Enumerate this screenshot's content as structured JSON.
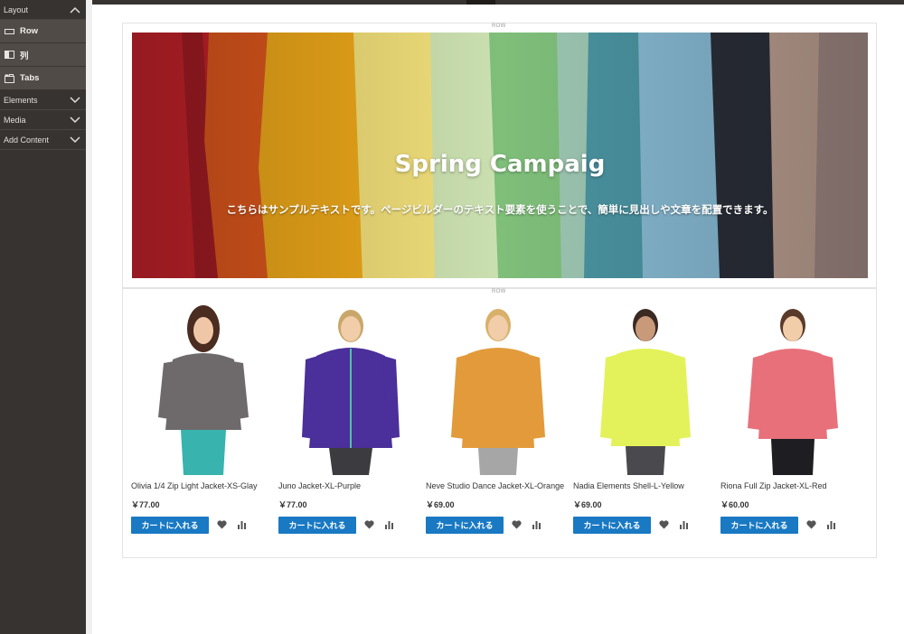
{
  "sidebar": {
    "layout_heading": "Layout",
    "items": [
      {
        "label": "Row",
        "icon": "row-icon"
      },
      {
        "label": "列",
        "icon": "column-icon"
      },
      {
        "label": "Tabs",
        "icon": "tabs-icon"
      }
    ],
    "sections": [
      {
        "label": "Elements",
        "icon": "chevron-down-icon"
      },
      {
        "label": "Media",
        "icon": "chevron-down-icon"
      },
      {
        "label": "Add Content",
        "icon": "chevron-down-icon"
      }
    ]
  },
  "stage": {
    "row_label": "ROW",
    "banner": {
      "title": "Spring Campaig",
      "subtitle": "こちらはサンプルテキストです。ページビルダーのテキスト要素を使うことで、簡単に見出しや文章を配置できます。"
    },
    "products": [
      {
        "name": "Olivia 1/4 Zip Light Jacket-XS-Glay",
        "price": "￥77.00",
        "color": "#6e6a6c"
      },
      {
        "name": "Juno Jacket-XL-Purple",
        "price": "￥77.00",
        "color": "#4b2f9a"
      },
      {
        "name": "Neve Studio Dance Jacket-XL-Orange",
        "price": "￥69.00",
        "color": "#e39a3b"
      },
      {
        "name": "Nadia Elements Shell-L-Yellow",
        "price": "￥69.00",
        "color": "#e3f25a"
      },
      {
        "name": "Riona Full Zip Jacket-XL-Red",
        "price": "￥60.00",
        "color": "#e8707a"
      }
    ],
    "add_to_cart_label": "カートに入れる"
  },
  "colors": {
    "panel_bg": "#373330",
    "panel_item_bg": "#514b47",
    "button_blue": "#1979c3"
  }
}
